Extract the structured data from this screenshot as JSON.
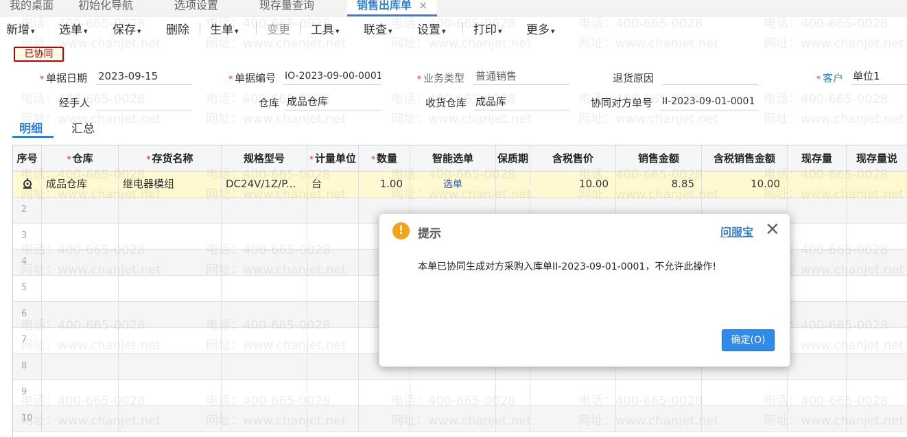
{
  "tabs": [
    {
      "label": "我的桌面"
    },
    {
      "label": "初始化导航"
    },
    {
      "label": "选项设置"
    },
    {
      "label": "现存量查询"
    },
    {
      "label": "销售出库单",
      "close": "×"
    }
  ],
  "toolbar": {
    "new": "新增",
    "select": "选单",
    "save": "保存",
    "delete": "删除",
    "generate": "生单",
    "change": "变更",
    "tools": "工具",
    "linked_query": "联查",
    "settings": "设置",
    "print": "打印",
    "more": "更多",
    "caret": "▾"
  },
  "status_badge": "已协同",
  "header": {
    "required_mark": "*",
    "doc_date_label": "单据日期",
    "doc_date": "2023-09-15",
    "doc_no_label": "单据编号",
    "doc_no": "IO-2023-09-00-0001",
    "biz_type_label": "业务类型",
    "biz_type": "普通销售",
    "return_reason_label": "退货原因",
    "return_reason": "",
    "customer_label": "客户",
    "customer": "单位1",
    "handler_label": "经手人",
    "handler": "",
    "warehouse_label": "仓库",
    "warehouse": "成品仓库",
    "receive_wh_label": "收货仓库",
    "receive_wh": "成品库",
    "partner_doc_label": "协同对方单号",
    "partner_doc": "II-2023-09-01-0001"
  },
  "detail_tabs": {
    "detail": "明细",
    "summary": "汇总"
  },
  "grid": {
    "columns": [
      {
        "label": "序号",
        "required": false
      },
      {
        "label": "仓库",
        "required": true
      },
      {
        "label": "存货名称",
        "required": true
      },
      {
        "label": "规格型号",
        "required": false
      },
      {
        "label": "计量单位",
        "required": true
      },
      {
        "label": "数量",
        "required": true
      },
      {
        "label": "智能选单",
        "required": false
      },
      {
        "label": "保质期",
        "required": false
      },
      {
        "label": "含税售价",
        "required": false
      },
      {
        "label": "销售金额",
        "required": false
      },
      {
        "label": "含税销售金额",
        "required": false
      },
      {
        "label": "现存量",
        "required": false
      },
      {
        "label": "现存量说",
        "required": false
      }
    ],
    "row1": {
      "warehouse": "成品仓库",
      "item": "继电器模组",
      "spec": "DC24V/1Z/P...",
      "unit": "台",
      "qty": "1.00",
      "pick": "选单",
      "shelf": "",
      "price": "10.00",
      "amount": "8.85",
      "tax_amount": "10.00",
      "stock": "",
      "stock_note": ""
    },
    "row_numbers": [
      "2",
      "3",
      "4",
      "5",
      "6",
      "7",
      "8",
      "9",
      "10"
    ]
  },
  "watermark": {
    "phone": "电话：400-665-0028",
    "site": "网址：www.chanjet.net"
  },
  "dialog": {
    "icon": "!",
    "title": "提示",
    "help_link": "问服宝",
    "close": "✕",
    "message": "本单已协同生成对方采购入库单II-2023-09-01-0001，不允许此操作!",
    "ok_button": "确定(O)"
  },
  "colors": {
    "accent": "#2f7fdc",
    "required": "#e02020",
    "badge": "#c00000",
    "warn": "#f5a31a"
  }
}
